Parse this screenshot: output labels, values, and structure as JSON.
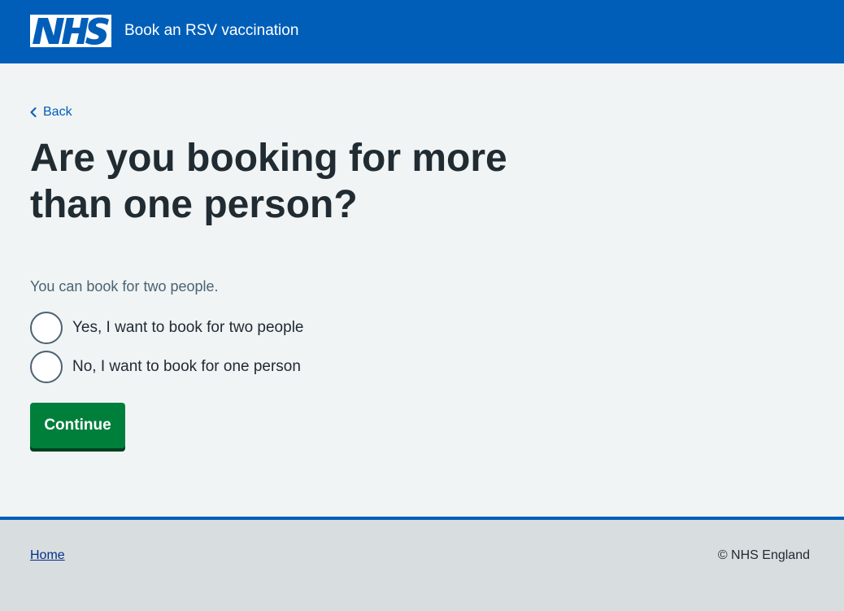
{
  "header": {
    "logo_text": "NHS",
    "service_name": "Book an RSV vaccination"
  },
  "main": {
    "back_label": "Back",
    "title": "Are you booking for more than one person?",
    "hint": "You can book for two people.",
    "options": [
      {
        "label": "Yes, I want to book for two people",
        "selected": false
      },
      {
        "label": "No, I want to book for one person",
        "selected": false
      }
    ],
    "continue_label": "Continue"
  },
  "footer": {
    "home_label": "Home",
    "copyright": "© NHS England"
  },
  "colors": {
    "header_blue": "#005eb8",
    "page_background": "#f0f4f5",
    "button_green": "#007f3b",
    "footer_grey": "#d8dde0",
    "text": "#212b32",
    "hint_text": "#4c6272"
  }
}
